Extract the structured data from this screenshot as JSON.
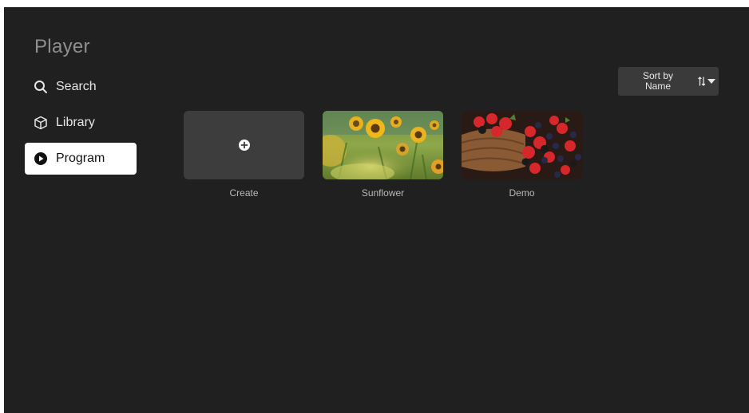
{
  "app": {
    "title": "Player"
  },
  "nav": {
    "items": [
      {
        "label": "Search",
        "icon": "search-icon",
        "active": false
      },
      {
        "label": "Library",
        "icon": "cube-icon",
        "active": false
      },
      {
        "label": "Program",
        "icon": "play-circle-icon",
        "active": true
      }
    ]
  },
  "sort": {
    "line1": "Sort by",
    "line2": "Name",
    "icons": [
      "sort-order-icon",
      "caret-down-icon"
    ]
  },
  "tiles": [
    {
      "label": "Create",
      "icon": "add-circle-icon"
    },
    {
      "label": "Sunflower"
    },
    {
      "label": "Demo"
    }
  ],
  "colors": {
    "background": "#202020",
    "tile": "#3d3d3d",
    "active_nav": "#ffffff",
    "sort_button": "#3a3a3a"
  }
}
